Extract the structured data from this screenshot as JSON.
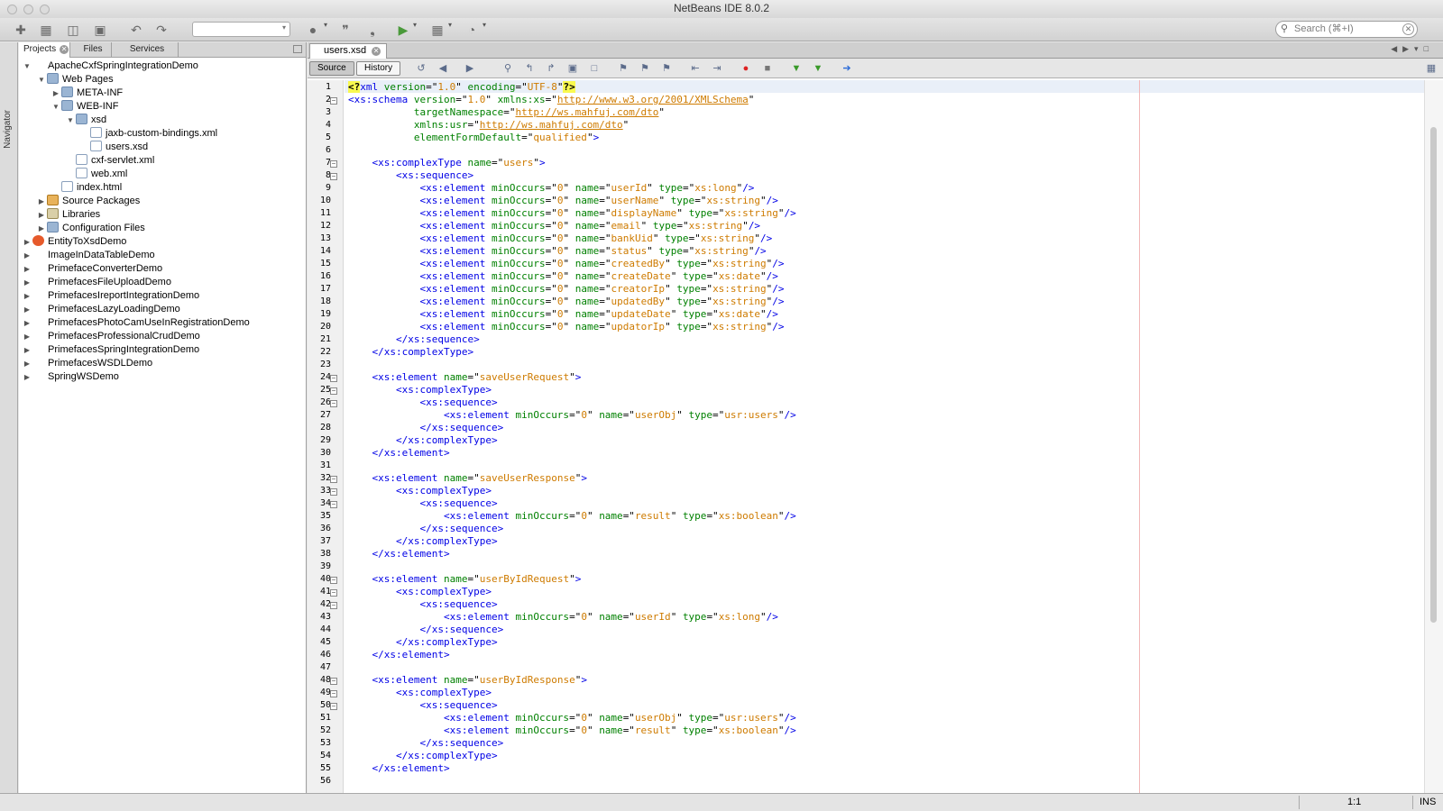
{
  "window": {
    "title": "NetBeans IDE 8.0.2"
  },
  "toolbar": {
    "search_placeholder": "Search (⌘+I)",
    "icons": [
      "new-file-icon",
      "new-project-icon",
      "open-project-icon",
      "close-project-icon",
      "undo-icon",
      "redo-icon",
      "build-icon",
      "clean-build-icon",
      "run-icon",
      "debug-icon",
      "profile-icon"
    ]
  },
  "navigator": {
    "label": "Navigator"
  },
  "projects_panel": {
    "tabs": [
      "Projects",
      "Files",
      "Services"
    ],
    "tree": [
      {
        "label": "ApacheCxfSpringIntegrationDemo",
        "depth": 0,
        "state": "open",
        "icon": "project"
      },
      {
        "label": "Web Pages",
        "depth": 1,
        "state": "open",
        "icon": "folder"
      },
      {
        "label": "META-INF",
        "depth": 2,
        "state": "closed",
        "icon": "folder"
      },
      {
        "label": "WEB-INF",
        "depth": 2,
        "state": "open",
        "icon": "folder"
      },
      {
        "label": "xsd",
        "depth": 3,
        "state": "open",
        "icon": "folder"
      },
      {
        "label": "jaxb-custom-bindings.xml",
        "depth": 4,
        "state": "leaf",
        "icon": "file"
      },
      {
        "label": "users.xsd",
        "depth": 4,
        "state": "leaf",
        "icon": "file"
      },
      {
        "label": "cxf-servlet.xml",
        "depth": 3,
        "state": "leaf",
        "icon": "file"
      },
      {
        "label": "web.xml",
        "depth": 3,
        "state": "leaf",
        "icon": "file"
      },
      {
        "label": "index.html",
        "depth": 2,
        "state": "leaf",
        "icon": "file"
      },
      {
        "label": "Source Packages",
        "depth": 1,
        "state": "closed",
        "icon": "pkg"
      },
      {
        "label": "Libraries",
        "depth": 1,
        "state": "closed",
        "icon": "lib"
      },
      {
        "label": "Configuration Files",
        "depth": 1,
        "state": "closed",
        "icon": "folder"
      },
      {
        "label": "EntityToXsdDemo",
        "depth": 0,
        "state": "closed",
        "icon": "java"
      },
      {
        "label": "ImageInDataTableDemo",
        "depth": 0,
        "state": "closed",
        "icon": "project"
      },
      {
        "label": "PrimefaceConverterDemo",
        "depth": 0,
        "state": "closed",
        "icon": "project"
      },
      {
        "label": "PrimefacesFileUploadDemo",
        "depth": 0,
        "state": "closed",
        "icon": "project"
      },
      {
        "label": "PrimefacesIreportIntegrationDemo",
        "depth": 0,
        "state": "closed",
        "icon": "project"
      },
      {
        "label": "PrimefacesLazyLoadingDemo",
        "depth": 0,
        "state": "closed",
        "icon": "project"
      },
      {
        "label": "PrimefacesPhotoCamUseInRegistrationDemo",
        "depth": 0,
        "state": "closed",
        "icon": "project"
      },
      {
        "label": "PrimefacesProfessionalCrudDemo",
        "depth": 0,
        "state": "closed",
        "icon": "project"
      },
      {
        "label": "PrimefacesSpringIntegrationDemo",
        "depth": 0,
        "state": "closed",
        "icon": "project"
      },
      {
        "label": "PrimefacesWSDLDemo",
        "depth": 0,
        "state": "closed",
        "icon": "project"
      },
      {
        "label": "SpringWSDemo",
        "depth": 0,
        "state": "closed",
        "icon": "project"
      }
    ]
  },
  "editor": {
    "tab_label": "users.xsd",
    "view_buttons": [
      "Source",
      "History"
    ],
    "fold_lines": [
      2,
      7,
      8,
      24,
      25,
      26,
      32,
      33,
      34,
      40,
      41,
      42,
      48,
      49,
      50
    ],
    "lines": [
      "<?xml version=\"1.0\" encoding=\"UTF-8\"?>",
      "<xs:schema version=\"1.0\" xmlns:xs=\"http://www.w3.org/2001/XMLSchema\"",
      "           targetNamespace=\"http://ws.mahfuj.com/dto\"",
      "           xmlns:usr=\"http://ws.mahfuj.com/dto\"",
      "           elementFormDefault=\"qualified\">",
      "",
      "    <xs:complexType name=\"users\">",
      "        <xs:sequence>",
      "            <xs:element minOccurs=\"0\" name=\"userId\" type=\"xs:long\"/>",
      "            <xs:element minOccurs=\"0\" name=\"userName\" type=\"xs:string\"/>",
      "            <xs:element minOccurs=\"0\" name=\"displayName\" type=\"xs:string\"/>",
      "            <xs:element minOccurs=\"0\" name=\"email\" type=\"xs:string\"/>",
      "            <xs:element minOccurs=\"0\" name=\"bankUid\" type=\"xs:string\"/>",
      "            <xs:element minOccurs=\"0\" name=\"status\" type=\"xs:string\"/>",
      "            <xs:element minOccurs=\"0\" name=\"createdBy\" type=\"xs:string\"/>",
      "            <xs:element minOccurs=\"0\" name=\"createDate\" type=\"xs:date\"/>",
      "            <xs:element minOccurs=\"0\" name=\"creatorIp\" type=\"xs:string\"/>",
      "            <xs:element minOccurs=\"0\" name=\"updatedBy\" type=\"xs:string\"/>",
      "            <xs:element minOccurs=\"0\" name=\"updateDate\" type=\"xs:date\"/>",
      "            <xs:element minOccurs=\"0\" name=\"updatorIp\" type=\"xs:string\"/>",
      "        </xs:sequence>",
      "    </xs:complexType>",
      "",
      "    <xs:element name=\"saveUserRequest\">",
      "        <xs:complexType>",
      "            <xs:sequence>",
      "                <xs:element minOccurs=\"0\" name=\"userObj\" type=\"usr:users\"/>",
      "            </xs:sequence>",
      "        </xs:complexType>",
      "    </xs:element>",
      "",
      "    <xs:element name=\"saveUserResponse\">",
      "        <xs:complexType>",
      "            <xs:sequence>",
      "                <xs:element minOccurs=\"0\" name=\"result\" type=\"xs:boolean\"/>",
      "            </xs:sequence>",
      "        </xs:complexType>",
      "    </xs:element>",
      "",
      "    <xs:element name=\"userByIdRequest\">",
      "        <xs:complexType>",
      "            <xs:sequence>",
      "                <xs:element minOccurs=\"0\" name=\"userId\" type=\"xs:long\"/>",
      "            </xs:sequence>",
      "        </xs:complexType>",
      "    </xs:element>",
      "",
      "    <xs:element name=\"userByIdResponse\">",
      "        <xs:complexType>",
      "            <xs:sequence>",
      "                <xs:element minOccurs=\"0\" name=\"userObj\" type=\"usr:users\"/>",
      "                <xs:element minOccurs=\"0\" name=\"result\" type=\"xs:boolean\"/>",
      "            </xs:sequence>",
      "        </xs:complexType>",
      "    </xs:element>",
      ""
    ]
  },
  "status_bar": {
    "position": "1:1",
    "mode": "INS"
  }
}
